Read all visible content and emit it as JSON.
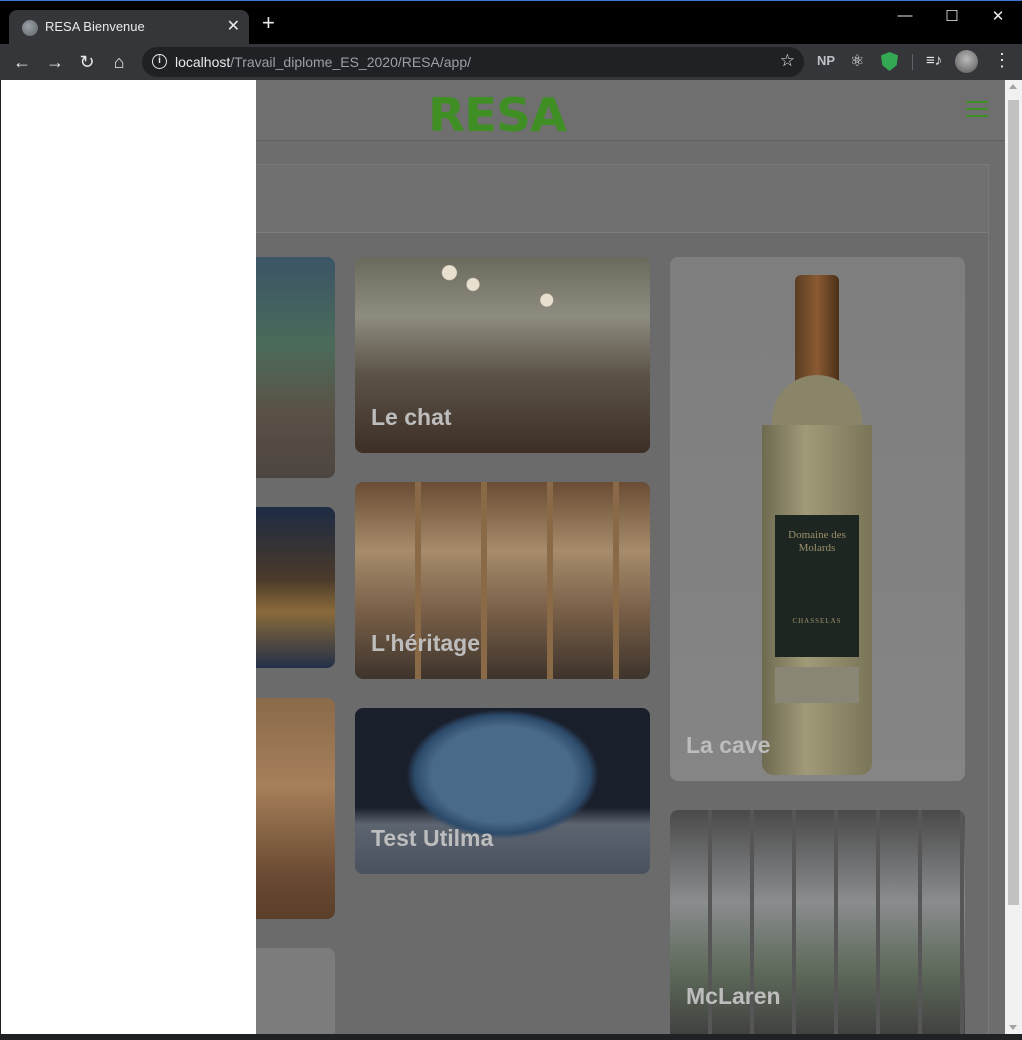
{
  "browser": {
    "tab_title": "RESA Bienvenue",
    "tab_close": "✕",
    "new_tab": "+",
    "url_host": "localhost",
    "url_path": "/Travail_diplome_ES_2020/RESA/app/",
    "ext_np": "NP",
    "window_minimize": "—",
    "window_maximize": "☐",
    "window_close": "✕"
  },
  "app": {
    "logo": "RESA",
    "accent_color": "#3f8f24"
  },
  "restaurants": {
    "col2": [
      {
        "label": "Le chat"
      },
      {
        "label": "L'héritage"
      },
      {
        "label": "Test Utilma"
      }
    ],
    "col3": [
      {
        "label": "La cave"
      },
      {
        "label": "McLaren"
      }
    ]
  },
  "bottle_label": {
    "title": "Domaine des Molards",
    "variety": "CHASSELAS"
  },
  "icons": [
    "back-icon",
    "forward-icon",
    "reload-icon",
    "home-icon",
    "info-icon",
    "star-icon",
    "atom-icon",
    "shield-icon",
    "media-icon",
    "menu-dots-icon",
    "hamburger-icon"
  ]
}
